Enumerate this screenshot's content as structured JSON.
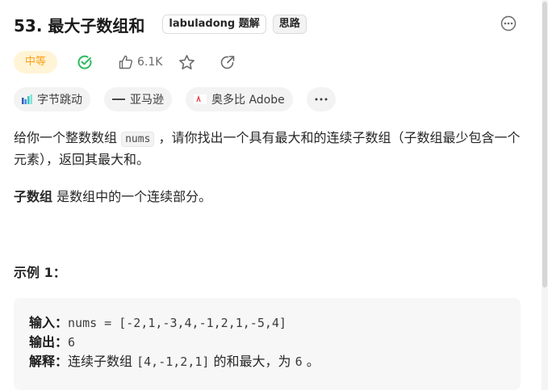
{
  "problem": {
    "title": "53. 最大子数组和",
    "tags": [
      "labuladong 题解",
      "思路"
    ],
    "difficulty": "中等",
    "likes": "6.1K",
    "companies": [
      "字节跳动",
      "亚马逊",
      "奥多比 Adobe"
    ],
    "more_label": "···"
  },
  "description": {
    "part1": "给你一个整数数组 ",
    "code": "nums",
    "part2": " ，请你找出一个具有最大和的连续子数组（子数组最少包含一个元素），返回其最大和。",
    "def_term": "子数组",
    "def_text": " 是数组中的一个连续部分。"
  },
  "example": {
    "title": "示例 1：",
    "input_label": "输入：",
    "input_value": "nums = [-2,1,-3,4,-1,2,1,-5,4]",
    "output_label": "输出：",
    "output_value": "6",
    "explain_label": "解释：",
    "explain_text1": "连续子数组 ",
    "explain_code": "[4,-1,2,1]",
    "explain_text2": " 的和最大，为 ",
    "explain_num": "6",
    "explain_text3": " 。"
  },
  "colors": {
    "accent_orange": "#ffa116",
    "difficulty_bg": "#fff4d6",
    "solved_green": "#2cbb5d"
  },
  "icons": {
    "solved": "check-circle-icon",
    "like": "thumb-up-icon",
    "favorite": "star-icon",
    "share": "share-icon",
    "menu": "more-circle-icon"
  }
}
